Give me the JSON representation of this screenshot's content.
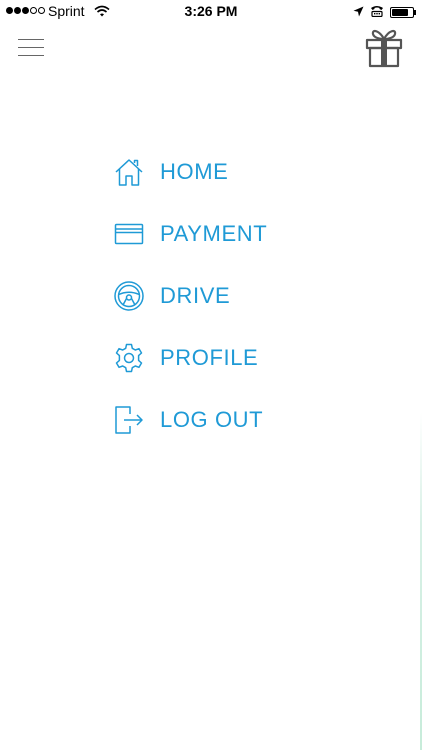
{
  "status_bar": {
    "carrier": "Sprint",
    "time": "3:26 PM",
    "signal_bars_on": 3,
    "signal_bars_total": 5,
    "battery_level": 0.9,
    "icons": [
      "wifi-icon",
      "location-arrow-icon",
      "tty-icon",
      "battery-icon"
    ]
  },
  "header": {
    "menu_icon": "hamburger-menu-icon",
    "gift_icon": "gift-icon"
  },
  "menu": {
    "items": [
      {
        "label": "HOME",
        "icon": "home-icon"
      },
      {
        "label": "PAYMENT",
        "icon": "credit-card-icon"
      },
      {
        "label": "DRIVE",
        "icon": "steering-wheel-icon"
      },
      {
        "label": "PROFILE",
        "icon": "gear-icon"
      },
      {
        "label": "LOG OUT",
        "icon": "logout-icon"
      }
    ]
  },
  "colors": {
    "accent": "#1f9ad6",
    "icon_gray": "#555555"
  }
}
